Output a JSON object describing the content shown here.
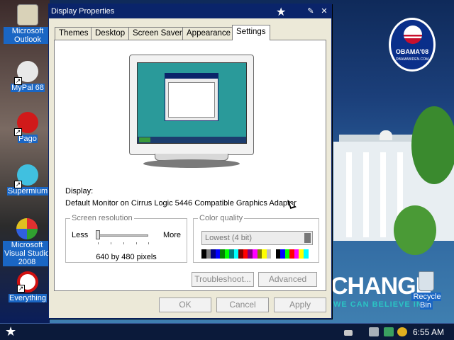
{
  "desktop": {
    "icons": [
      {
        "label": "Microsoft Outlook",
        "icon": "outlook-icon"
      },
      {
        "label": "MyPal 68",
        "icon": "mypal-icon"
      },
      {
        "label": "Pago",
        "icon": "pago-icon"
      },
      {
        "label": "Supermium",
        "icon": "supermium-icon"
      },
      {
        "label": "Microsoft Visual Studio 2008",
        "icon": "visual-studio-icon"
      },
      {
        "label": "Everything",
        "icon": "everything-icon"
      }
    ],
    "recycle_bin": {
      "label": "Recycle Bin",
      "icon": "recycle-bin-icon"
    },
    "wallpaper": {
      "badge_text": "OBAMA'08",
      "badge_small": "OBAMABIDEN.COM",
      "slogan": "CHANGE",
      "slogan_sub": "WE CAN BELIEVE IN"
    }
  },
  "window": {
    "title": "Display Properties",
    "title_icons": [
      "star-icon",
      "help-icon",
      "close-icon"
    ],
    "tabs": [
      {
        "label": "Themes",
        "active": false
      },
      {
        "label": "Desktop",
        "active": false
      },
      {
        "label": "Screen Saver",
        "active": false
      },
      {
        "label": "Appearance",
        "active": false
      },
      {
        "label": "Settings",
        "active": true
      }
    ],
    "settings": {
      "display_label": "Display:",
      "display_value": "Default Monitor on Cirrus Logic 5446 Compatible Graphics Adapter",
      "screen_resolution": {
        "legend": "Screen resolution",
        "less": "Less",
        "more": "More",
        "value": "640 by 480 pixels",
        "slider_position": 0
      },
      "color_quality": {
        "legend": "Color quality",
        "selected": "Lowest (4 bit)",
        "palette": [
          "#000000",
          "#808080",
          "#000080",
          "#0000ff",
          "#008000",
          "#00ff00",
          "#008080",
          "#00ffff",
          "#800000",
          "#ff0000",
          "#800080",
          "#ff00ff",
          "#808000",
          "#ffff00",
          "#c0c0c0",
          "#ffffff",
          "#000000",
          "#0000ff",
          "#00ff00",
          "#ff0000",
          "#ff00ff",
          "#ffff00",
          "#00ffff",
          "#ffffff"
        ]
      },
      "troubleshoot_label": "Troubleshoot...",
      "advanced_label": "Advanced"
    },
    "footer": {
      "ok_label": "OK",
      "cancel_label": "Cancel",
      "apply_label": "Apply"
    }
  },
  "taskbar": {
    "start_icon": "star-icon",
    "tray_icons": [
      "keyboard-icon",
      "network-icon",
      "shield-icon",
      "search-icon"
    ],
    "clock": "6:55 AM"
  }
}
